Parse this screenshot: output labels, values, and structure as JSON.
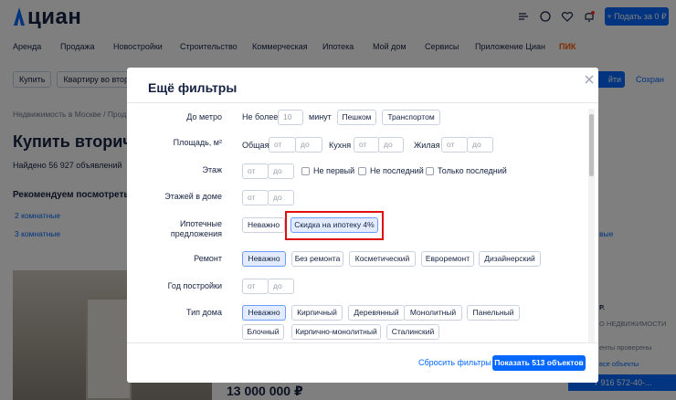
{
  "header": {
    "logo_text": "циан",
    "post_button": "+ Подать за 0 ₽"
  },
  "nav": [
    "Аренда",
    "Продажа",
    "Новостройки",
    "Строительство",
    "Коммерческая",
    "Ипотека",
    "Мой дом",
    "Сервисы",
    "Приложение Циан",
    "ПИК"
  ],
  "filters_bar": {
    "chips": [
      "Купить",
      "Квартиру во вторич"
    ],
    "find_button": "йти",
    "save_link": "Сохран"
  },
  "breadcrumb": "Недвижимость в Москве  /  Прод",
  "page_title": "Купить вторичку",
  "found_text": "Найдено 56 927 объявлений",
  "recommend": {
    "title": "Рекомендуем посмотреть",
    "links": [
      "2 комнатные",
      "3 комнатные"
    ],
    "links_right": [
      "",
      "вые"
    ]
  },
  "listing": {
    "price": "13 000 000 ₽",
    "side_lines": [
      "Р.",
      "О НЕДВИЖИМОСТИ",
      "енты проверены",
      "все объекты"
    ],
    "phone": "7 916 572-40-..."
  },
  "modal": {
    "title": "Ещё фильтры",
    "footer": {
      "reset": "Сбросить фильтры",
      "show": "Показать 513 объектов"
    },
    "metro": {
      "label": "До метро",
      "prefix": "Не более",
      "value_placeholder": "10",
      "unit": "минут",
      "options": [
        "Пешком",
        "Транспортом"
      ]
    },
    "area": {
      "label": "Площадь, м²",
      "groups": [
        "Общая",
        "Кухня",
        "Жилая"
      ],
      "from": "от",
      "to": "до"
    },
    "floor": {
      "label": "Этаж",
      "from": "от",
      "to": "до",
      "checks": [
        "Не первый",
        "Не последний",
        "Только последний"
      ]
    },
    "floors_total": {
      "label": "Этажей в доме",
      "from": "от",
      "to": "до"
    },
    "mortgage": {
      "label_line1": "Ипотечные",
      "label_line2": "предложения",
      "options": [
        "Неважно",
        "Скидка на ипотеку 4%"
      ],
      "selected": "Скидка на ипотеку 4%"
    },
    "repair": {
      "label": "Ремонт",
      "options": [
        "Неважно",
        "Без ремонта",
        "Косметический",
        "Евроремонт",
        "Дизайнерский"
      ],
      "selected": "Неважно"
    },
    "build_year": {
      "label": "Год постройки",
      "from": "от",
      "to": "до"
    },
    "house_type": {
      "label": "Тип дома",
      "options_row1": [
        "Неважно",
        "Кирпичный",
        "Деревянный",
        "Монолитный",
        "Панельный"
      ],
      "options_row2": [
        "Блочный",
        "Кирпично-монолитный",
        "Сталинский"
      ],
      "selected": "Неважно"
    }
  },
  "colors": {
    "accent": "#0468ff",
    "highlight": "#e01010",
    "selected_bg": "#e3ecff",
    "pik": "#ff5a00"
  }
}
